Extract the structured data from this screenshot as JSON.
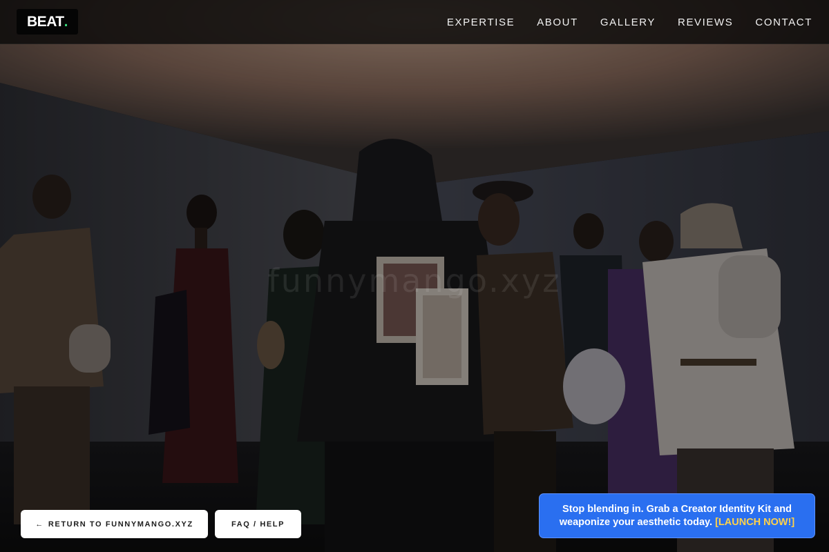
{
  "brand": {
    "name": "BEAT",
    "dot": ".",
    "dot_color": "#37d67a"
  },
  "nav": {
    "items": [
      {
        "label": "EXPERTISE"
      },
      {
        "label": "ABOUT"
      },
      {
        "label": "GALLERY"
      },
      {
        "label": "REVIEWS"
      },
      {
        "label": "CONTACT"
      }
    ]
  },
  "hero": {
    "watermark": "funnymango.xyz"
  },
  "actions": {
    "return_arrow": "←",
    "return_label": "RETURN TO FUNNYMANGO.XYZ",
    "faq_label": "FAQ / HELP"
  },
  "promo": {
    "text": "Stop blending in. Grab a Creator Identity Kit and weaponize your aesthetic today.",
    "cta": "[LAUNCH NOW!]",
    "background": "#2a6ff0",
    "cta_color": "#ffd24a"
  }
}
